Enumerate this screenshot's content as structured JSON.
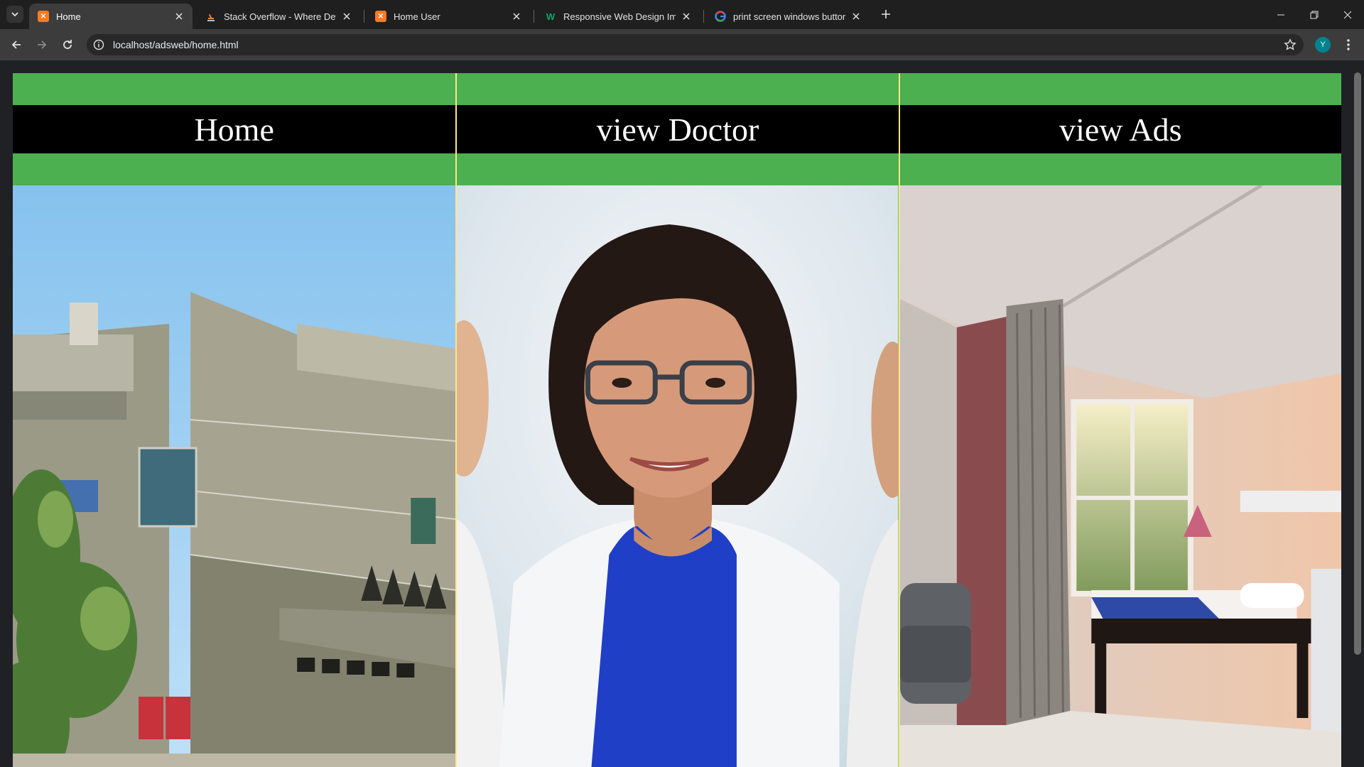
{
  "browser": {
    "tabs": [
      {
        "title": "Home",
        "active": true,
        "icon": "xampp-icon"
      },
      {
        "title": "Stack Overflow - Where Develo",
        "active": false,
        "icon": "stackoverflow-icon"
      },
      {
        "title": "Home User",
        "active": false,
        "icon": "xampp-icon"
      },
      {
        "title": "Responsive Web Design Images",
        "active": false,
        "icon": "w3schools-icon"
      },
      {
        "title": "print screen windows button - G",
        "active": false,
        "icon": "google-icon"
      }
    ],
    "url": "localhost/adsweb/home.html",
    "profile_initial": "Y"
  },
  "page": {
    "panels": [
      {
        "label": "Home",
        "image": "hospital-building-photo"
      },
      {
        "label": "view Doctor",
        "image": "doctor-portrait-photo"
      },
      {
        "label": "view Ads",
        "image": "hospital-room-photo"
      }
    ],
    "colors": {
      "band": "#4caf50",
      "header_bg": "#000000",
      "divider": "#fde68a"
    }
  }
}
